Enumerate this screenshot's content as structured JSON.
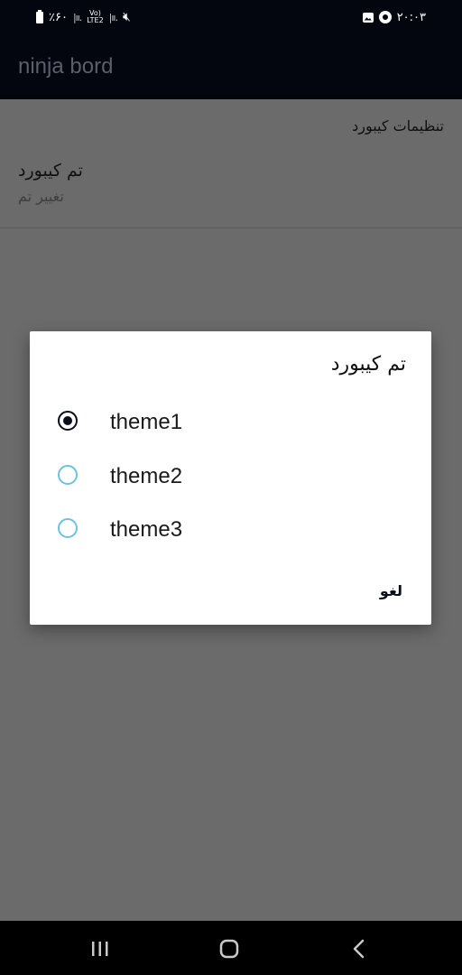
{
  "status_bar": {
    "battery_percent": "٪۶۰",
    "network_label_top": "Vo)",
    "network_label_bottom": "LTE2",
    "time": "۲۰:۰۳"
  },
  "app_bar": {
    "title": "ninja bord"
  },
  "settings": {
    "section_header": "تنظیمات کیبورد",
    "pref_title": "تم کیبورد",
    "pref_summary": "تغییر تم"
  },
  "dialog": {
    "title": "تم کیبورد",
    "options": [
      {
        "label": "theme1",
        "selected": true
      },
      {
        "label": "theme2",
        "selected": false
      },
      {
        "label": "theme3",
        "selected": false
      }
    ],
    "cancel_label": "لغو"
  },
  "nav_bar": {
    "icons": [
      "recent-apps-icon",
      "home-icon",
      "back-icon"
    ]
  },
  "colors": {
    "radio_unselected": "#6ec3dc",
    "radio_selected": "#0a0e1c",
    "app_bar": "#03050f",
    "scrim_background": "#6b6b6b"
  }
}
